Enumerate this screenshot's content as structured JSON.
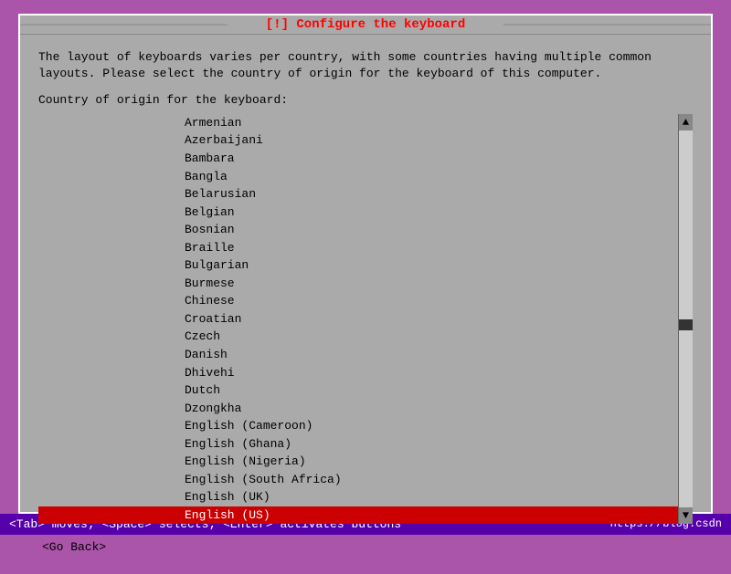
{
  "dialog": {
    "title": "[!] Configure the keyboard",
    "description_line1": "The layout of keyboards varies per country, with some countries having multiple common",
    "description_line2": "layouts. Please select the country of origin for the keyboard of this computer.",
    "country_label": "Country of origin for the keyboard:",
    "list_items": [
      {
        "id": "armenian",
        "label": "Armenian",
        "selected": false
      },
      {
        "id": "azerbaijani",
        "label": "Azerbaijani",
        "selected": false
      },
      {
        "id": "bambara",
        "label": "Bambara",
        "selected": false
      },
      {
        "id": "bangla",
        "label": "Bangla",
        "selected": false
      },
      {
        "id": "belarusian",
        "label": "Belarusian",
        "selected": false
      },
      {
        "id": "belgian",
        "label": "Belgian",
        "selected": false
      },
      {
        "id": "bosnian",
        "label": "Bosnian",
        "selected": false
      },
      {
        "id": "braille",
        "label": "Braille",
        "selected": false
      },
      {
        "id": "bulgarian",
        "label": "Bulgarian",
        "selected": false
      },
      {
        "id": "burmese",
        "label": "Burmese",
        "selected": false
      },
      {
        "id": "chinese",
        "label": "Chinese",
        "selected": false
      },
      {
        "id": "croatian",
        "label": "Croatian",
        "selected": false
      },
      {
        "id": "czech",
        "label": "Czech",
        "selected": false
      },
      {
        "id": "danish",
        "label": "Danish",
        "selected": false
      },
      {
        "id": "dhivehi",
        "label": "Dhivehi",
        "selected": false
      },
      {
        "id": "dutch",
        "label": "Dutch",
        "selected": false
      },
      {
        "id": "dzongkha",
        "label": "Dzongkha",
        "selected": false
      },
      {
        "id": "english-cameroon",
        "label": "English (Cameroon)",
        "selected": false
      },
      {
        "id": "english-ghana",
        "label": "English (Ghana)",
        "selected": false
      },
      {
        "id": "english-nigeria",
        "label": "English (Nigeria)",
        "selected": false
      },
      {
        "id": "english-south-africa",
        "label": "English (South Africa)",
        "selected": false
      },
      {
        "id": "english-uk",
        "label": "English (UK)",
        "selected": false
      },
      {
        "id": "english-us",
        "label": "English (US)",
        "selected": true
      }
    ],
    "go_back_label": "<Go Back>"
  },
  "status_bar": {
    "left": "<Tab> moves; <Space> selects; <Enter> activates buttons",
    "right": "https://blog.csdn"
  },
  "scrollbar": {
    "up_arrow": "▲",
    "down_arrow": "▼"
  }
}
